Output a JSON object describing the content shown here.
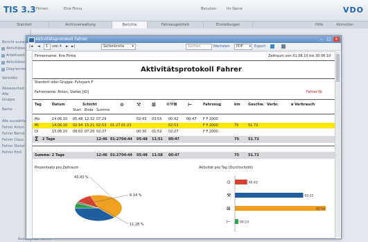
{
  "app": {
    "title": "TIS 3.3",
    "header_items": [
      "Firmen",
      "Eine Firma",
      "Benutzer",
      "Ihr Name"
    ],
    "logo": "VDO",
    "right_links": [
      "Hilfe",
      "Abmelden"
    ]
  },
  "nav": {
    "tabs": [
      "Standort",
      "Archivverwaltung",
      "Berichte",
      "Fahrzeugeinheit",
      "Einstellungen"
    ],
    "active": "Berichte"
  },
  "sidebar": {
    "items": [
      "Bericht auswählen",
      "Aktivitäten",
      "Arbeitszeit",
      "Aktivitäten",
      "Diagramme",
      "Verstöße",
      "Abwesenheit",
      "Alle",
      "Gruppe",
      "Name",
      "Alle auswählen",
      "Fahrer Anton",
      "Fahrer Bernd",
      "Fahrer Claus",
      "Fahrer Dieter",
      "Fahrer Emil"
    ],
    "bottom_label": "Auswahl der Fahrer"
  },
  "window": {
    "title": "Aktivitätsprotokoll Fahrer",
    "toolbar": {
      "page": "1",
      "page_of": "von 4",
      "zoom": "Seitenbreite",
      "search_placeholder": "Suchen",
      "next_label": "Nächsten",
      "format": "PDF",
      "export": "Export"
    }
  },
  "report": {
    "company": "Firmenname: Ihre Firma",
    "period": "Zeitraum von 01.06.10 bis 30.06.10",
    "title": "Aktivitätsprotokoll Fahrer",
    "group": "Standort oder Gruppe: Fuhrpark F",
    "driver": "Fahrername: Anton, Stefan [ID]",
    "driver_ref": "Fahrer-Nr.",
    "columns": {
      "tag": "Tag",
      "datum": "Datum",
      "schicht": "Schicht",
      "start": "Start",
      "ende": "Ende",
      "summe": "Summe",
      "fahrzeug": "Fahrzeug",
      "km": "km",
      "geschw": "Geschw.",
      "verbr": "Verbr.",
      "verbrauch": "ø Verbrauch"
    },
    "rows": [
      {
        "tag": "Mo",
        "datum": "14.06.10",
        "start": "05:48",
        "ende": "12:32",
        "summe": "07:29",
        "a": "",
        "b": "02:43",
        "c": "03:55",
        "d": "00:42",
        "e": "00:47",
        "fahrzeug": "F F 2000",
        "km": "",
        "geschw": "",
        "highlight": false
      },
      {
        "tag": "Mi",
        "datum": "14.06.10",
        "start": "02:34",
        "ende": "15:21",
        "summe": "02:53",
        "a": "01:27",
        "b": "01:23",
        "c": "",
        "d": "02:53",
        "e": "",
        "fahrzeug": "F F 2000",
        "km": "75",
        "geschw": "51.72",
        "highlight": true
      },
      {
        "tag": "Di",
        "datum": "15.06.10",
        "start": "08:02",
        "ende": "07:20",
        "summe": "02:27",
        "a": "",
        "b": "00:30",
        "c": "01:52",
        "d": "02:27",
        "e": "",
        "fahrzeug": "F F 2000",
        "km": "",
        "geschw": "",
        "highlight": false
      }
    ],
    "subtotal": {
      "label": "2 Tage",
      "summe": "12:46",
      "a": "01:27",
      "b": "04:44",
      "c": "05:48",
      "d": "11:51",
      "e": "00:47",
      "km": "75",
      "geschw": "51.72"
    },
    "total": {
      "label": "Summe: 2 Tage",
      "summe": "12:46",
      "a": "01:27",
      "b": "04:44",
      "c": "05:48",
      "d": "11:58",
      "e": "00:47",
      "km": "75",
      "geschw": "51.72"
    },
    "pie_title": "Prozentsatz pro Zeitraum",
    "bar_title": "Aktivität pro Tag (Durchschnitt)"
  },
  "chart_data": [
    {
      "type": "pie",
      "title": "Prozentsatz pro Zeitraum",
      "slices": [
        {
          "label": "43.43 %",
          "value": 43.43,
          "color": "#f0a020"
        },
        {
          "label": "",
          "value": 37.03,
          "color": "#1f5f9f"
        },
        {
          "label": "6.14 %",
          "value": 6.14,
          "color": "#2aa24a"
        },
        {
          "label": "",
          "value": 2.1,
          "color": "#777777"
        },
        {
          "label": "11.28 %",
          "value": 11.28,
          "color": "#d84030"
        }
      ]
    },
    {
      "type": "bar",
      "title": "Aktivität pro Tag (Durchschnitt)",
      "categories": [
        "Bereitschaft",
        "Arbeitszeit",
        "Lenkzeit",
        "Ruhezeit"
      ],
      "values": [
        0.76,
        4.22,
        5.62,
        0.21
      ],
      "labels": [
        "00:43",
        "02:22",
        "02:54",
        "00:23"
      ],
      "colors": [
        "#d84030",
        "#1f5f9f",
        "#f0a020",
        "#2aa24a"
      ],
      "xlim": [
        0,
        6
      ]
    }
  ]
}
